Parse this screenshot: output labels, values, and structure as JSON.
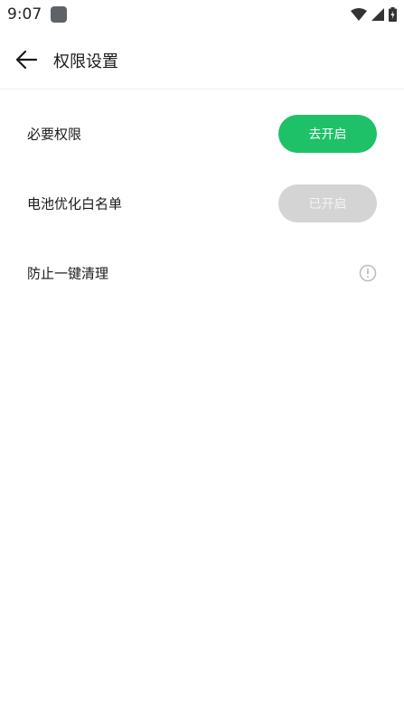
{
  "status_bar": {
    "time": "9:07",
    "icons": [
      "app-notification-icon",
      "wifi-icon",
      "signal-icon",
      "battery-icon"
    ]
  },
  "header": {
    "title": "权限设置",
    "back_icon": "arrow-left-icon"
  },
  "rows": [
    {
      "label": "必要权限",
      "action": "去开启",
      "state": "enabled"
    },
    {
      "label": "电池优化白名单",
      "action": "已开启",
      "state": "disabled"
    },
    {
      "label": "防止一键清理",
      "icon": "info-icon"
    }
  ],
  "colors": {
    "accent_green": "#1ec168",
    "disabled_gray": "#d4d4d4",
    "text": "#1a1a1a",
    "divider": "#ececec"
  }
}
